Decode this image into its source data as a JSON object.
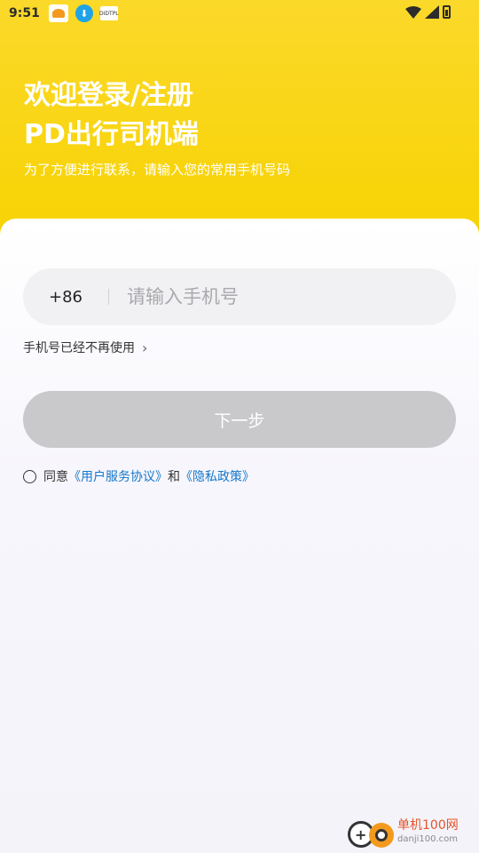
{
  "status_bar": {
    "time": "9:51",
    "notif_3_text": "DIDTPL"
  },
  "header": {
    "title_line1": "欢迎登录/注册",
    "title_line2": "PD出行司机端",
    "subtitle": "为了方便进行联系，请输入您的常用手机号码"
  },
  "login": {
    "country_code": "+86",
    "phone_placeholder": "请输入手机号",
    "phone_value": "",
    "no_longer_used_label": "手机号已经不再使用",
    "next_button_label": "下一步"
  },
  "agreement": {
    "prefix": "同意",
    "user_agreement": "《用户服务协议》",
    "and": "和",
    "privacy_policy": "《隐私政策》"
  },
  "watermark": {
    "name": "单机100网",
    "url": "danji100.com"
  },
  "colors": {
    "header_yellow": "#f7d200",
    "link_blue": "#1677c9",
    "button_disabled": "#c9c9cb"
  }
}
